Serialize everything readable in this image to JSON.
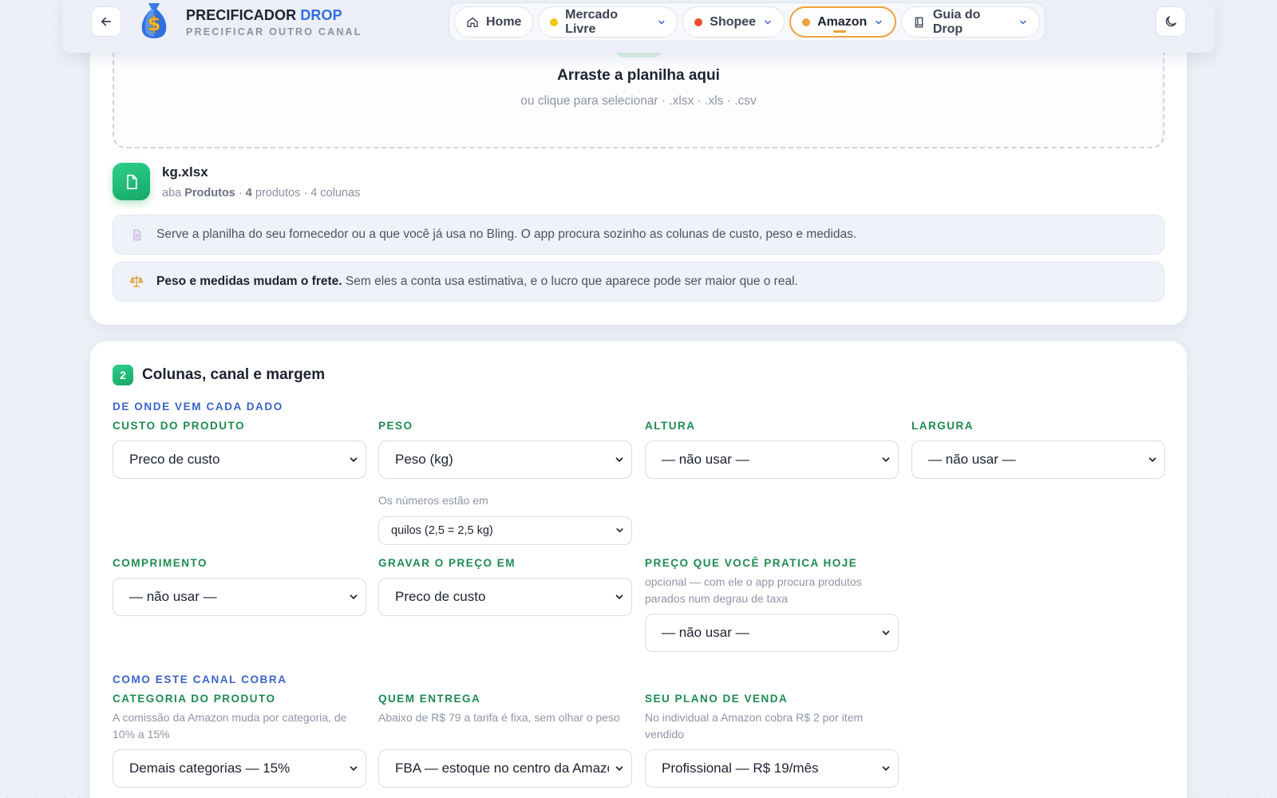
{
  "header": {
    "brand_main": "PRECIFICADOR",
    "brand_accent": "DROP",
    "subtitle": "PRECIFICAR OUTRO CANAL",
    "nav": [
      {
        "label": "Home",
        "icon": "home-icon"
      },
      {
        "label": "Mercado Livre",
        "dot": "#f2c80f"
      },
      {
        "label": "Shopee",
        "dot": "#ee4d2d"
      },
      {
        "label": "Amazon",
        "dot": "#f0a03a",
        "active": true
      },
      {
        "label": "Guia do Drop",
        "icon": "book-icon"
      }
    ]
  },
  "upload": {
    "title": "Arraste a planilha aqui",
    "subtitle": "ou clique para selecionar · .xlsx · .xls · .csv",
    "file": {
      "name": "kg.xlsx",
      "meta_prefix": "aba",
      "sheet": "Produtos",
      "products_count": "4",
      "products_label": "produtos · 4 colunas"
    },
    "notice1": "Serve a planilha do seu fornecedor ou a que você já usa no Bling. O app procura sozinho as colunas de custo, peso e medidas.",
    "notice2_bold": "Peso e medidas mudam o frete.",
    "notice2_rest": "Sem eles a conta usa estimativa, e o lucro que aparece pode ser maior que o real."
  },
  "step2": {
    "badge": "2",
    "title": "Colunas, canal e margem",
    "section_source": "DE ONDE VEM CADA DADO",
    "fields": {
      "custo": {
        "label": "CUSTO DO PRODUTO",
        "value": "Preco de custo"
      },
      "peso": {
        "label": "PESO",
        "value": "Peso (kg)",
        "unit_help": "Os números estão em",
        "unit_value": "quilos (2,5 = 2,5 kg)"
      },
      "altura": {
        "label": "ALTURA",
        "value": "— não usar —"
      },
      "largura": {
        "label": "LARGURA",
        "value": "— não usar —"
      },
      "comprimento": {
        "label": "COMPRIMENTO",
        "value": "— não usar —"
      },
      "gravar": {
        "label": "GRAVAR O PREÇO EM",
        "value": "Preco de custo"
      },
      "preco_hoje": {
        "label": "PREÇO QUE VOCÊ PRATICA HOJE",
        "help": "opcional — com ele o app procura produtos parados num degrau de taxa",
        "value": "— não usar —"
      }
    },
    "section_channel": "COMO ESTE CANAL COBRA",
    "channel": {
      "categoria": {
        "label": "CATEGORIA DO PRODUTO",
        "help": "A comissão da Amazon muda por categoria, de 10% a 15%",
        "value": "Demais categorias — 15%"
      },
      "entrega": {
        "label": "QUEM ENTREGA",
        "help": "Abaixo de R$ 79 a tarifa é fixa, sem olhar o peso",
        "value": "FBA — estoque no centro da Amazon"
      },
      "plano": {
        "label": "SEU PLANO DE VENDA",
        "help": "No individual a Amazon cobra R$ 2 por item vendido",
        "value": "Profissional — R$ 19/mês"
      }
    }
  }
}
